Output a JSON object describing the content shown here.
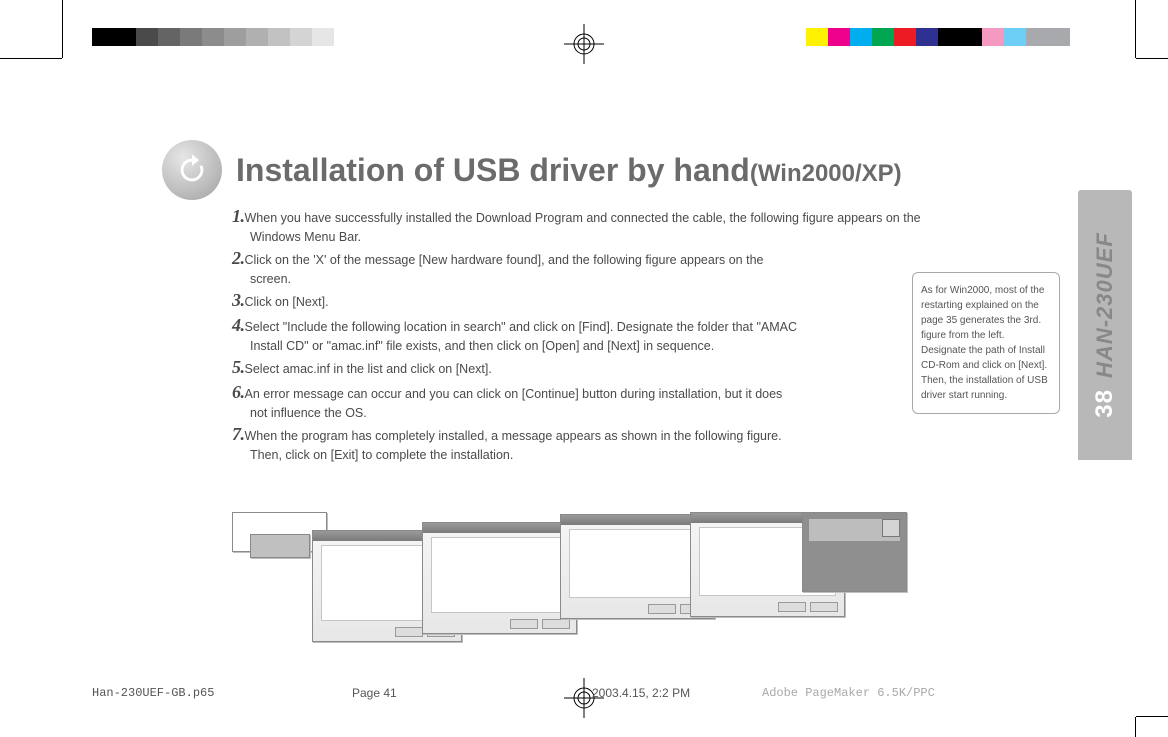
{
  "colorbar_left": [
    "#000000",
    "#000000",
    "#4a4a4a",
    "#646464",
    "#7a7a7a",
    "#8c8c8c",
    "#9e9e9e",
    "#b0b0b0",
    "#c2c2c2",
    "#d4d4d4",
    "#e6e6e6",
    "#ffffff",
    "#ffffff",
    "#ffffff"
  ],
  "colorbar_right": [
    "#fff200",
    "#ec008c",
    "#00aeef",
    "#00a651",
    "#ed1c24",
    "#2e3192",
    "#000000",
    "#000000",
    "#f49ac1",
    "#6dcff6",
    "#a7a9ac",
    "#a7a9ac"
  ],
  "sidetab": {
    "page_num": "38",
    "model": "HAN-230UEF"
  },
  "title": {
    "main": "Installation of USB driver by hand",
    "sub": "(Win2000/XP)"
  },
  "steps": [
    {
      "n": "1.",
      "a": "When you have successfully installed the Download Program and connected the cable, the following figure appears on the",
      "b": "Windows Menu Bar."
    },
    {
      "n": "2.",
      "a": "Click on the 'X' of the message [New hardware found], and the following figure appears on the",
      "b": "screen."
    },
    {
      "n": "3.",
      "a": "Click on [Next].",
      "b": ""
    },
    {
      "n": "4.",
      "a": "Select \"Include the following location in search\" and click on [Find]. Designate the folder that \"AMAC",
      "b": "Install CD\" or \"amac.inf\" file exists, and then click on [Open] and [Next] in sequence."
    },
    {
      "n": "5.",
      "a": "Select amac.inf in the list and click on [Next].",
      "b": ""
    },
    {
      "n": "6.",
      "a": "An error message can occur and you can click on [Continue] button during installation, but it does",
      "b": "not influence the OS."
    },
    {
      "n": "7.",
      "a": "When the program has completely installed, a message appears as shown in the following figure.",
      "b": "Then, click on [Exit] to complete the installation."
    }
  ],
  "note": "As for Win2000, most of the restarting explained on the page 35 generates the 3rd. figure from the left. Designate the path of Install CD-Rom and click on [Next]. Then, the installation of USB driver start running.",
  "footer": {
    "filename": "Han-230UEF-GB.p65",
    "page": "Page 41",
    "datetime": "2003.4.15, 2:2 PM",
    "app": "Adobe PageMaker 6.5K/PPC"
  }
}
